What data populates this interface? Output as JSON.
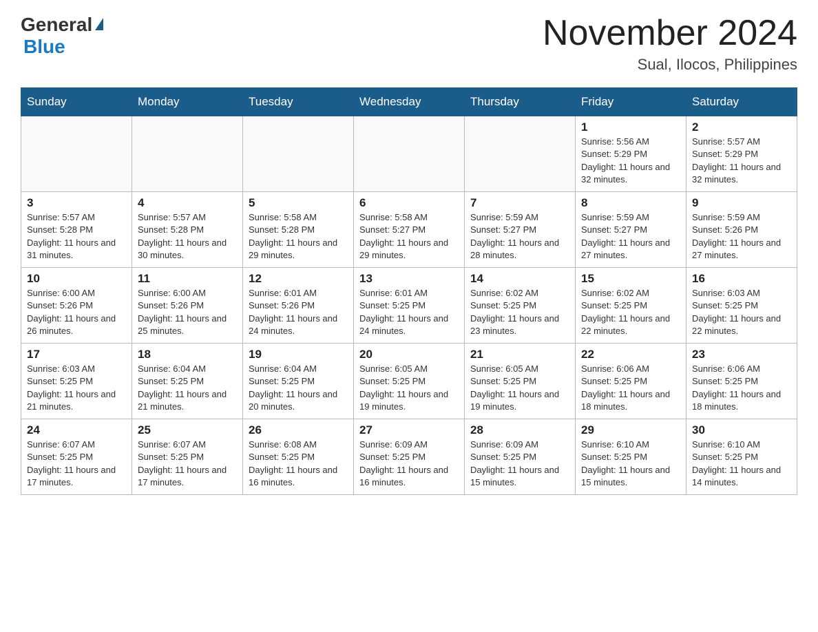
{
  "header": {
    "logo_general": "General",
    "logo_blue": "Blue",
    "month_title": "November 2024",
    "location": "Sual, Ilocos, Philippines"
  },
  "days_of_week": [
    "Sunday",
    "Monday",
    "Tuesday",
    "Wednesday",
    "Thursday",
    "Friday",
    "Saturday"
  ],
  "weeks": [
    {
      "days": [
        {
          "number": "",
          "info": ""
        },
        {
          "number": "",
          "info": ""
        },
        {
          "number": "",
          "info": ""
        },
        {
          "number": "",
          "info": ""
        },
        {
          "number": "",
          "info": ""
        },
        {
          "number": "1",
          "info": "Sunrise: 5:56 AM\nSunset: 5:29 PM\nDaylight: 11 hours and 32 minutes."
        },
        {
          "number": "2",
          "info": "Sunrise: 5:57 AM\nSunset: 5:29 PM\nDaylight: 11 hours and 32 minutes."
        }
      ]
    },
    {
      "days": [
        {
          "number": "3",
          "info": "Sunrise: 5:57 AM\nSunset: 5:28 PM\nDaylight: 11 hours and 31 minutes."
        },
        {
          "number": "4",
          "info": "Sunrise: 5:57 AM\nSunset: 5:28 PM\nDaylight: 11 hours and 30 minutes."
        },
        {
          "number": "5",
          "info": "Sunrise: 5:58 AM\nSunset: 5:28 PM\nDaylight: 11 hours and 29 minutes."
        },
        {
          "number": "6",
          "info": "Sunrise: 5:58 AM\nSunset: 5:27 PM\nDaylight: 11 hours and 29 minutes."
        },
        {
          "number": "7",
          "info": "Sunrise: 5:59 AM\nSunset: 5:27 PM\nDaylight: 11 hours and 28 minutes."
        },
        {
          "number": "8",
          "info": "Sunrise: 5:59 AM\nSunset: 5:27 PM\nDaylight: 11 hours and 27 minutes."
        },
        {
          "number": "9",
          "info": "Sunrise: 5:59 AM\nSunset: 5:26 PM\nDaylight: 11 hours and 27 minutes."
        }
      ]
    },
    {
      "days": [
        {
          "number": "10",
          "info": "Sunrise: 6:00 AM\nSunset: 5:26 PM\nDaylight: 11 hours and 26 minutes."
        },
        {
          "number": "11",
          "info": "Sunrise: 6:00 AM\nSunset: 5:26 PM\nDaylight: 11 hours and 25 minutes."
        },
        {
          "number": "12",
          "info": "Sunrise: 6:01 AM\nSunset: 5:26 PM\nDaylight: 11 hours and 24 minutes."
        },
        {
          "number": "13",
          "info": "Sunrise: 6:01 AM\nSunset: 5:25 PM\nDaylight: 11 hours and 24 minutes."
        },
        {
          "number": "14",
          "info": "Sunrise: 6:02 AM\nSunset: 5:25 PM\nDaylight: 11 hours and 23 minutes."
        },
        {
          "number": "15",
          "info": "Sunrise: 6:02 AM\nSunset: 5:25 PM\nDaylight: 11 hours and 22 minutes."
        },
        {
          "number": "16",
          "info": "Sunrise: 6:03 AM\nSunset: 5:25 PM\nDaylight: 11 hours and 22 minutes."
        }
      ]
    },
    {
      "days": [
        {
          "number": "17",
          "info": "Sunrise: 6:03 AM\nSunset: 5:25 PM\nDaylight: 11 hours and 21 minutes."
        },
        {
          "number": "18",
          "info": "Sunrise: 6:04 AM\nSunset: 5:25 PM\nDaylight: 11 hours and 21 minutes."
        },
        {
          "number": "19",
          "info": "Sunrise: 6:04 AM\nSunset: 5:25 PM\nDaylight: 11 hours and 20 minutes."
        },
        {
          "number": "20",
          "info": "Sunrise: 6:05 AM\nSunset: 5:25 PM\nDaylight: 11 hours and 19 minutes."
        },
        {
          "number": "21",
          "info": "Sunrise: 6:05 AM\nSunset: 5:25 PM\nDaylight: 11 hours and 19 minutes."
        },
        {
          "number": "22",
          "info": "Sunrise: 6:06 AM\nSunset: 5:25 PM\nDaylight: 11 hours and 18 minutes."
        },
        {
          "number": "23",
          "info": "Sunrise: 6:06 AM\nSunset: 5:25 PM\nDaylight: 11 hours and 18 minutes."
        }
      ]
    },
    {
      "days": [
        {
          "number": "24",
          "info": "Sunrise: 6:07 AM\nSunset: 5:25 PM\nDaylight: 11 hours and 17 minutes."
        },
        {
          "number": "25",
          "info": "Sunrise: 6:07 AM\nSunset: 5:25 PM\nDaylight: 11 hours and 17 minutes."
        },
        {
          "number": "26",
          "info": "Sunrise: 6:08 AM\nSunset: 5:25 PM\nDaylight: 11 hours and 16 minutes."
        },
        {
          "number": "27",
          "info": "Sunrise: 6:09 AM\nSunset: 5:25 PM\nDaylight: 11 hours and 16 minutes."
        },
        {
          "number": "28",
          "info": "Sunrise: 6:09 AM\nSunset: 5:25 PM\nDaylight: 11 hours and 15 minutes."
        },
        {
          "number": "29",
          "info": "Sunrise: 6:10 AM\nSunset: 5:25 PM\nDaylight: 11 hours and 15 minutes."
        },
        {
          "number": "30",
          "info": "Sunrise: 6:10 AM\nSunset: 5:25 PM\nDaylight: 11 hours and 14 minutes."
        }
      ]
    }
  ]
}
